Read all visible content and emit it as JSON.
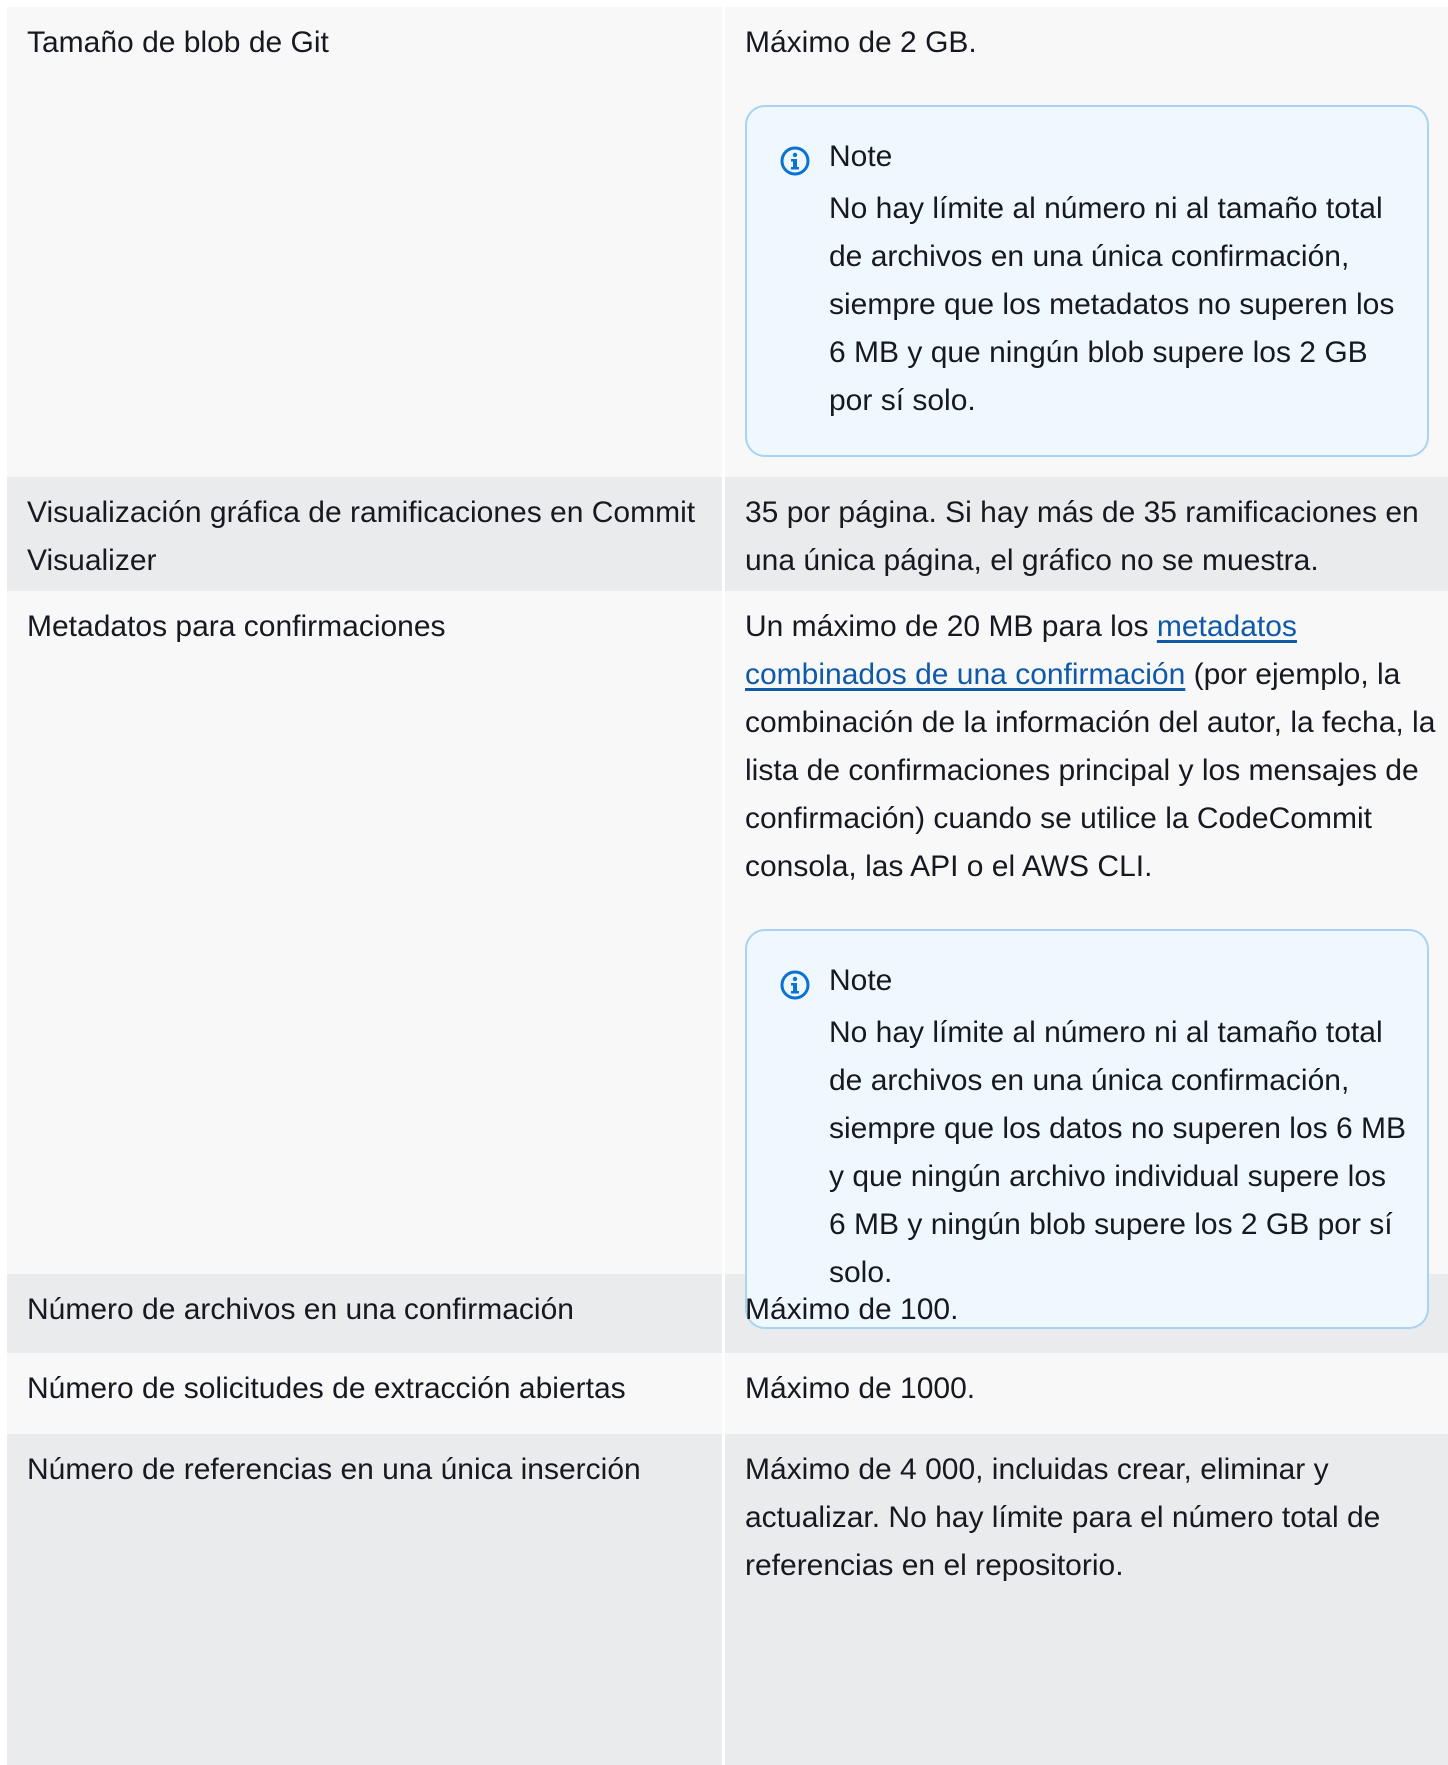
{
  "rows": [
    {
      "label": "Tamaño de blob de Git",
      "value": "Máximo de 2 GB.",
      "note": {
        "title": "Note",
        "text": "No hay límite al número ni al tamaño total de archivos en una única confirmación, siempre que los metadatos no superen los 6 MB y que ningún blob supere los 2 GB por sí solo."
      }
    },
    {
      "label": "Visualización gráfica de ramificaciones en Commit Visualizer",
      "value": "35 por página. Si hay más de 35 ramificaciones en una única página, el gráfico no se muestra."
    },
    {
      "label": "Metadatos para confirmaciones",
      "value_before": "Un máximo de 20 MB para los ",
      "value_link": "metadatos combinados de una confirmación",
      "value_after": " (por ejemplo, la combinación de la información del autor, la fecha, la lista de confirmaciones principal y los mensajes de confirmación) cuando se utilice la CodeCommit consola, las API o el AWS CLI.",
      "note": {
        "title": "Note",
        "text": "No hay límite al número ni al tamaño total de archivos en una única confirmación, siempre que los datos no superen los 6 MB y que ningún archivo individual supere los 6 MB y ningún blob supere los 2 GB por sí solo."
      }
    },
    {
      "label": "Número de archivos en una confirmación",
      "value": "Máximo de 100."
    },
    {
      "label": "Número de solicitudes de extracción abiertas",
      "value": "Máximo de 1000."
    },
    {
      "label": "Número de referencias en una única inserción",
      "value": "Máximo de 4 000, incluidas crear, eliminar y actualizar. No hay límite para el número total de referencias en el repositorio."
    }
  ],
  "colors": {
    "row_light": "#f8f8f9",
    "row_dark": "#e9ebed",
    "note_bg": "#f0f8ff",
    "note_border": "#a8d3f2",
    "link": "#0f5aa8",
    "info_icon": "#0972d3"
  },
  "icons": {
    "note": "info-circle-icon"
  }
}
